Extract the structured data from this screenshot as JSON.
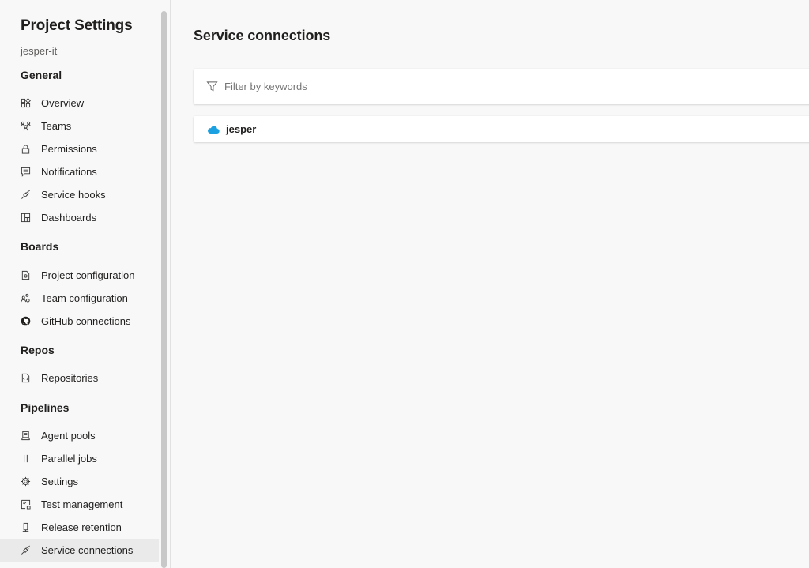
{
  "sidebar": {
    "title": "Project Settings",
    "project": "jesper-it",
    "sections": {
      "general": "General",
      "boards": "Boards",
      "repos": "Repos",
      "pipelines": "Pipelines"
    },
    "items": {
      "overview": {
        "label": "Overview",
        "icon": "overview-icon"
      },
      "teams": {
        "label": "Teams",
        "icon": "teams-icon"
      },
      "permissions": {
        "label": "Permissions",
        "icon": "lock-icon"
      },
      "notifications": {
        "label": "Notifications",
        "icon": "message-icon"
      },
      "service_hooks": {
        "label": "Service hooks",
        "icon": "plug-icon"
      },
      "dashboards": {
        "label": "Dashboards",
        "icon": "dashboard-icon"
      },
      "project_configuration": {
        "label": "Project configuration",
        "icon": "document-settings-icon"
      },
      "team_configuration": {
        "label": "Team configuration",
        "icon": "team-settings-icon"
      },
      "github_connections": {
        "label": "GitHub connections",
        "icon": "github-icon"
      },
      "repositories": {
        "label": "Repositories",
        "icon": "code-file-icon"
      },
      "agent_pools": {
        "label": "Agent pools",
        "icon": "build-agent-icon"
      },
      "parallel_jobs": {
        "label": "Parallel jobs",
        "icon": "parallel-icon"
      },
      "settings": {
        "label": "Settings",
        "icon": "gear-icon"
      },
      "test_management": {
        "label": "Test management",
        "icon": "test-icon"
      },
      "release_retention": {
        "label": "Release retention",
        "icon": "retention-icon"
      },
      "service_connections": {
        "label": "Service connections",
        "icon": "plug-icon",
        "selected": true
      }
    }
  },
  "main": {
    "title": "Service connections",
    "filter": {
      "placeholder": "Filter by keywords",
      "value": ""
    },
    "connections": [
      {
        "name": "jesper",
        "icon": "cloud-icon",
        "icon_color": "#1ba1e2"
      }
    ]
  }
}
